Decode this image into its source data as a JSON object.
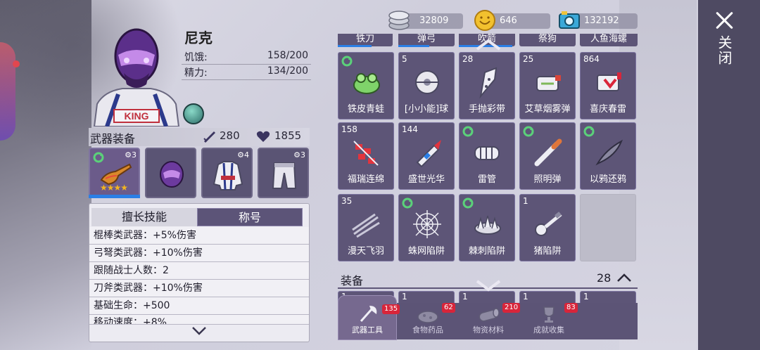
{
  "close": {
    "label": "关闭"
  },
  "character": {
    "name": "尼克",
    "stats": [
      {
        "label": "饥饿:",
        "value": "158/200"
      },
      {
        "label": "精力:",
        "value": "134/200"
      }
    ],
    "badge_text": "KING"
  },
  "equipment_header": {
    "title": "武器装备",
    "attack": "280",
    "health": "1855"
  },
  "equip_slots": [
    {
      "stars": "3",
      "rarity_stars": "★★★★",
      "selected": true
    },
    {
      "stars": "",
      "selected": false
    },
    {
      "stars": "4",
      "selected": false
    },
    {
      "stars": "3",
      "selected": false
    }
  ],
  "skills": {
    "tabs": [
      "擅长技能",
      "称号"
    ],
    "rows": [
      "棍棒类武器：+5%伤害",
      "弓弩类武器：+10%伤害",
      "跟随战士人数：2",
      "刀斧类武器：+10%伤害",
      "基础生命：+500",
      "移动速度：+8%"
    ]
  },
  "currency": [
    {
      "icon": "silver-coin-stack-icon",
      "value": "32809"
    },
    {
      "icon": "gold-coin-icon",
      "value": "646"
    },
    {
      "icon": "camera-ticket-icon",
      "value": "132192"
    }
  ],
  "grid_tabs": [
    "铁刀",
    "弹弓",
    "吹箭",
    "祭狗",
    "人鱼海螺"
  ],
  "items": [
    {
      "name": "铁皮青蛙",
      "count": "",
      "cycle": true
    },
    {
      "name": "[小小能]球",
      "count": "5",
      "cycle": false
    },
    {
      "name": "手抛彩带",
      "count": "28",
      "cycle": false
    },
    {
      "name": "艾草烟雾弹",
      "count": "25",
      "cycle": false
    },
    {
      "name": "喜庆春雷",
      "count": "864",
      "cycle": false
    },
    {
      "name": "福瑞连绵",
      "count": "158",
      "cycle": false
    },
    {
      "name": "盛世光华",
      "count": "144",
      "cycle": false
    },
    {
      "name": "雷管",
      "count": "",
      "cycle": true
    },
    {
      "name": "照明弹",
      "count": "",
      "cycle": true
    },
    {
      "name": "以鸦还鸦",
      "count": "",
      "cycle": true
    },
    {
      "name": "漫天飞羽",
      "count": "35",
      "cycle": false
    },
    {
      "name": "蛛网陷阱",
      "count": "",
      "cycle": true
    },
    {
      "name": "棘刺陷阱",
      "count": "",
      "cycle": true
    },
    {
      "name": "猪陷阱",
      "count": "1",
      "cycle": false
    }
  ],
  "equipment_section": {
    "title": "装备",
    "count": "28",
    "peek_counts": [
      "1",
      "1",
      "1",
      "1",
      "1"
    ]
  },
  "bottom_tabs": [
    {
      "label": "武器工具",
      "badge": "135",
      "active": true
    },
    {
      "label": "食物药品",
      "badge": "62",
      "active": false
    },
    {
      "label": "物资材料",
      "badge": "210",
      "active": false
    },
    {
      "label": "成就收集",
      "badge": "83",
      "active": false
    }
  ],
  "colors": {
    "panel": "#5d5577",
    "accent_blue": "#2b7fe6",
    "badge_red": "#d8253a",
    "close_panel": "#4e4a62"
  }
}
